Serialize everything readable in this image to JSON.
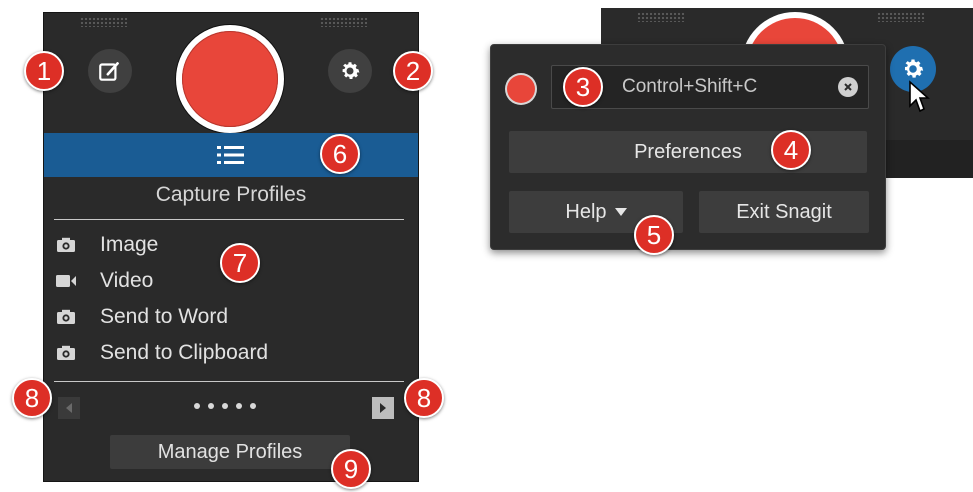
{
  "capture_panel": {
    "section_title": "Capture Profiles",
    "profiles": [
      {
        "label": "Image",
        "icon": "camera-icon"
      },
      {
        "label": "Video",
        "icon": "video-camera-icon"
      },
      {
        "label": "Send to Word",
        "icon": "camera-icon"
      },
      {
        "label": "Send to Clipboard",
        "icon": "camera-icon"
      }
    ],
    "manage_label": "Manage Profiles",
    "page_dots": 5
  },
  "popup": {
    "hotkey": "Control+Shift+C",
    "preferences_label": "Preferences",
    "help_label": "Help",
    "exit_label": "Exit Snagit"
  },
  "callouts": [
    "1",
    "2",
    "3",
    "4",
    "5",
    "6",
    "7",
    "8",
    "8",
    "9"
  ],
  "colors": {
    "record_red": "#e8463a",
    "tray_blue": "#1a5c94",
    "gear_blue": "#1f6fb0",
    "callout_red": "#dd2f26",
    "panel_bg": "#2a2a2a"
  }
}
